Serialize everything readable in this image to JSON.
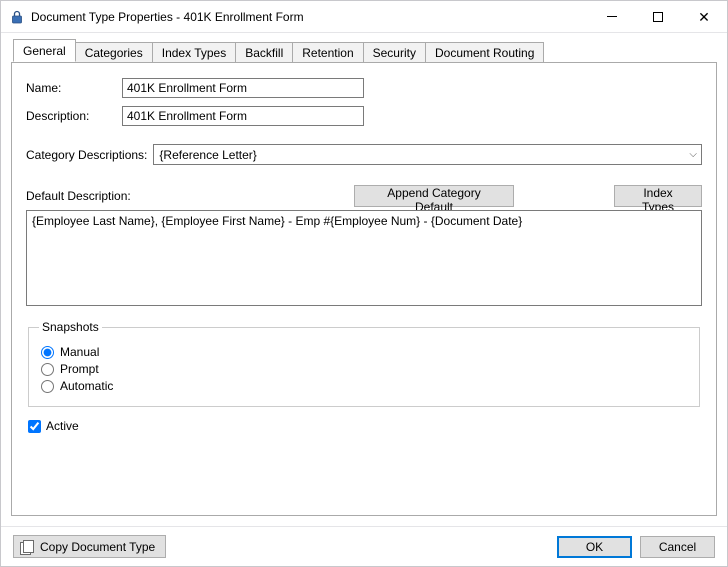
{
  "window": {
    "title": "Document Type Properties  - 401K Enrollment Form"
  },
  "tabs": [
    {
      "label": "General",
      "active": true
    },
    {
      "label": "Categories",
      "active": false
    },
    {
      "label": "Index Types",
      "active": false
    },
    {
      "label": "Backfill",
      "active": false
    },
    {
      "label": "Retention",
      "active": false
    },
    {
      "label": "Security",
      "active": false
    },
    {
      "label": "Document Routing",
      "active": false
    }
  ],
  "form": {
    "name_label": "Name:",
    "name_value": "401K Enrollment Form",
    "description_label": "Description:",
    "description_value": "401K Enrollment Form",
    "category_descriptions_label": "Category Descriptions:",
    "category_descriptions_value": "{Reference Letter}",
    "default_description_label": "Default Description:",
    "append_button": "Append Category Default",
    "index_types_button": "Index Types",
    "default_description_value": "{Employee Last Name}, {Employee First Name} - Emp #{Employee Num} - {Document Date}"
  },
  "snapshots": {
    "legend": "Snapshots",
    "manual": "Manual",
    "prompt": "Prompt",
    "automatic": "Automatic",
    "selected": "manual"
  },
  "active": {
    "label": "Active",
    "checked": true
  },
  "footer": {
    "copy_button": "Copy Document Type",
    "ok": "OK",
    "cancel": "Cancel"
  }
}
